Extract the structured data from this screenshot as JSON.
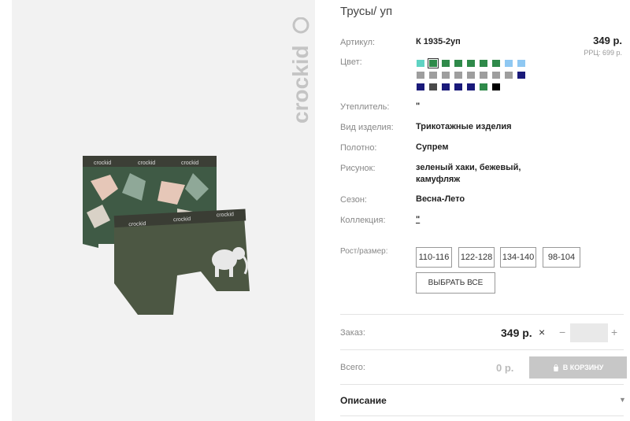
{
  "product": {
    "title": "Трусы/ уп",
    "brand": "crockid",
    "price": "349 р.",
    "rrp": "РРЦ: 699 р."
  },
  "details": {
    "article_label": "Артикул:",
    "article_value": "К 1935-2уп",
    "color_label": "Цвет:",
    "insulation_label": "Утеплитель:",
    "insulation_value": "\"",
    "type_label": "Вид изделия:",
    "type_value": "Трикотажные изделия",
    "fabric_label": "Полотно:",
    "fabric_value": "Супрем",
    "pattern_label": "Рисунок:",
    "pattern_value_line1": "зеленый хаки, бежевый,",
    "pattern_value_line2": "камуфляж",
    "season_label": "Сезон:",
    "season_value": "Весна-Лето",
    "collection_label": "Коллекция:",
    "collection_value": "\"",
    "size_label": "Рост/размер:"
  },
  "swatches": [
    [
      "#5fd3c3",
      "#2f8a4a",
      "#2f8a4a",
      "#2f8a4a",
      "#2f8a4a",
      "#2f8a4a",
      "#2f8a4a",
      "#8fc8f2",
      "#8fc8f2"
    ],
    [
      "#9e9e9e",
      "#9e9e9e",
      "#9e9e9e",
      "#9e9e9e",
      "#9e9e9e",
      "#9e9e9e",
      "#9e9e9e",
      "#9e9e9e",
      "#1a1a7a"
    ],
    [
      "#1a1a7a",
      "#4a4a4a",
      "#1a1a7a",
      "#1a1a7a",
      "#1a1a7a",
      "#2f8a4a",
      "#000000"
    ]
  ],
  "sizes": [
    "110-116",
    "122-128",
    "134-140",
    "98-104"
  ],
  "select_all": "ВЫБРАТЬ ВСЕ",
  "order": {
    "label": "Заказ:",
    "price": "349 р.",
    "remove": "×",
    "minus": "−",
    "plus": "+",
    "quantity": ""
  },
  "total": {
    "label": "Всего:",
    "value": "0 р.",
    "cart_button": "В КОРЗИНУ"
  },
  "description": {
    "label": "Описание",
    "arrow": "▼"
  }
}
